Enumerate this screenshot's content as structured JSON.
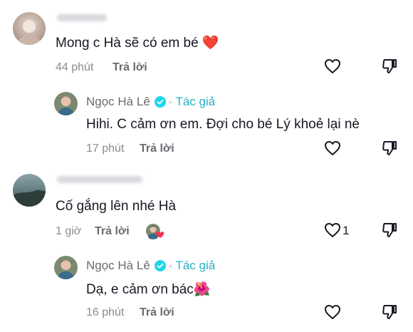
{
  "comments": [
    {
      "text": "Mong c Hà sẽ có em bé ❤️",
      "time": "44 phút",
      "reply_label": "Trả lời",
      "reply": {
        "author": "Ngọc Hà Lê",
        "tag": "Tác giả",
        "text": "Hihi. C cảm ơn em. Đợi cho bé Lý khoẻ lại nè",
        "time": "17 phút",
        "reply_label": "Trả lời"
      }
    },
    {
      "text": "Cố gắng lên nhé Hà",
      "time": "1 giờ",
      "reply_label": "Trả lời",
      "like_count": "1",
      "reply": {
        "author": "Ngọc Hà Lê",
        "tag": "Tác giả",
        "text": "Dạ, e cảm ơn bác🌺",
        "time": "16 phút",
        "reply_label": "Trả lời"
      }
    }
  ],
  "separator": "·",
  "icons": {
    "like": "heart-outline-icon",
    "dislike": "thumbs-down-outline-icon",
    "verified": "verified-check-icon",
    "author_liked": "creator-liked-avatar-icon"
  },
  "colors": {
    "text": "#161823",
    "muted": "#8a8b91",
    "author_tag": "#2ab0c5",
    "verified": "#20d5ec",
    "heart": "#fe2c55"
  }
}
